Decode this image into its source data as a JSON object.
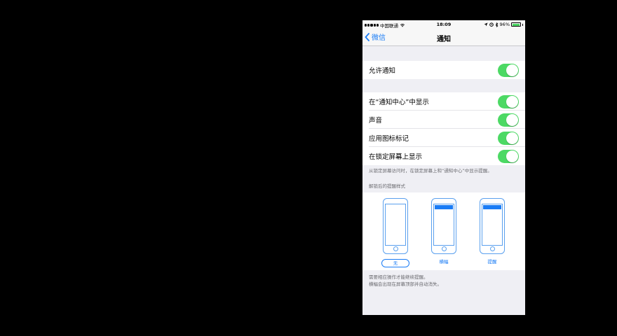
{
  "status_bar": {
    "carrier": "中国联通",
    "time": "18:09",
    "battery": "96%",
    "battery_level": 0.96
  },
  "nav": {
    "back_label": "微信",
    "title": "通知"
  },
  "allow": {
    "label": "允许通知",
    "on": true
  },
  "settings": [
    {
      "label": "在“通知中心”中显示",
      "on": true
    },
    {
      "label": "声音",
      "on": true
    },
    {
      "label": "应用图标标记",
      "on": true
    },
    {
      "label": "在锁定屏幕上显示",
      "on": true
    }
  ],
  "lockscreen_note": "从锁定屏幕访问时，在锁定屏幕上和“通知中心”中显示提醒。",
  "alert_style": {
    "header": "解锁后的提醒样式",
    "options": [
      "无",
      "横幅",
      "提醒"
    ],
    "selected": "无"
  },
  "footer": [
    "需要相应操作才能继续提醒。",
    "横幅会出现在屏幕顶部并自动消失。"
  ],
  "colors": {
    "toggle_on": "#4cd964",
    "accent": "#1a7cf5",
    "background": "#efeff4"
  }
}
